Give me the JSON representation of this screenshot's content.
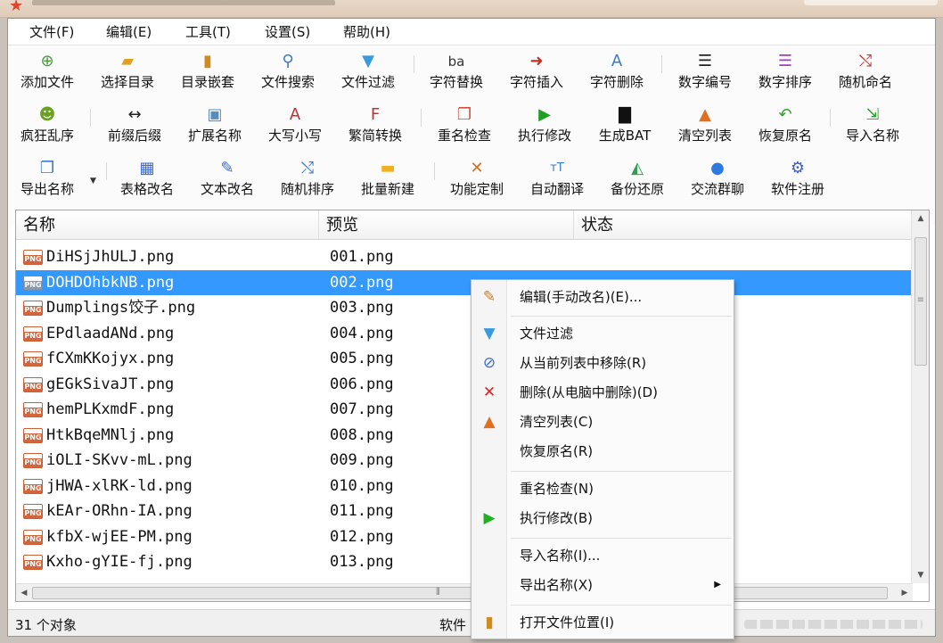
{
  "menubar": {
    "items": [
      "文件(F)",
      "编辑(E)",
      "工具(T)",
      "设置(S)",
      "帮助(H)"
    ]
  },
  "toolbar": {
    "row1": [
      "添加文件",
      "选择目录",
      "目录嵌套",
      "文件搜索",
      "文件过滤",
      "字符替换",
      "字符插入",
      "字符删除",
      "数字编号",
      "数字排序",
      "随机命名"
    ],
    "row2": [
      "疯狂乱序",
      "前缀后缀",
      "扩展名称",
      "大写小写",
      "繁简转换",
      "重名检查",
      "执行修改",
      "生成BAT",
      "清空列表",
      "恢复原名",
      "导入名称"
    ],
    "row3": [
      "导出名称",
      "表格改名",
      "文本改名",
      "随机排序",
      "批量新建",
      "功能定制",
      "自动翻译",
      "备份还原",
      "交流群聊",
      "软件注册"
    ],
    "row1_icon_texts": {
      "char_replace": "ba"
    }
  },
  "file_list": {
    "columns": [
      "名称",
      "预览",
      "状态"
    ],
    "icon_label": "PNG",
    "rows": [
      {
        "name": "DiHSjJhULJ.png",
        "preview": "001.png"
      },
      {
        "name": "DOHDOhbkNB.png",
        "preview": "002.png"
      },
      {
        "name": "Dumplings饺子.png",
        "preview": "003.png"
      },
      {
        "name": "EPdlaadANd.png",
        "preview": "004.png"
      },
      {
        "name": "fCXmKKojyx.png",
        "preview": "005.png"
      },
      {
        "name": "gEGkSivaJT.png",
        "preview": "006.png"
      },
      {
        "name": "hemPLKxmdF.png",
        "preview": "007.png"
      },
      {
        "name": "HtkBqeMNlj.png",
        "preview": "008.png"
      },
      {
        "name": "iOLI-SKvv-mL.png",
        "preview": "009.png"
      },
      {
        "name": "jHWA-xlRK-ld.png",
        "preview": "010.png"
      },
      {
        "name": "kEAr-ORhn-IA.png",
        "preview": "011.png"
      },
      {
        "name": "kfbX-wjEE-PM.png",
        "preview": "012.png"
      },
      {
        "name": "Kxho-gYIE-fj.png",
        "preview": "013.png"
      }
    ],
    "selected_index": 1,
    "selection_color": "#3399ff"
  },
  "context_menu": {
    "items": [
      {
        "label": "编辑(手动改名)(E)...",
        "icon": "edit-icon"
      },
      {
        "label": "文件过滤",
        "icon": "funnel-icon"
      },
      {
        "label": "从当前列表中移除(R)",
        "icon": "remove-icon"
      },
      {
        "label": "删除(从电脑中删除)(D)",
        "icon": "delete-x-icon"
      },
      {
        "label": "清空列表(C)",
        "icon": "broom-icon"
      },
      {
        "label": "恢复原名(R)",
        "icon": ""
      },
      {
        "label": "重名检查(N)",
        "icon": ""
      },
      {
        "label": "执行修改(B)",
        "icon": "play-icon"
      },
      {
        "label": "导入名称(I)...",
        "icon": ""
      },
      {
        "label": "导出名称(X)",
        "icon": "",
        "submenu": true
      },
      {
        "label": "打开文件位置(I)",
        "icon": "folder-open-icon"
      }
    ]
  },
  "statusbar": {
    "count": "31 个对象",
    "mid": "软件"
  },
  "colors": {
    "accent": "#3399ff",
    "png_icon": "#d3643c"
  }
}
